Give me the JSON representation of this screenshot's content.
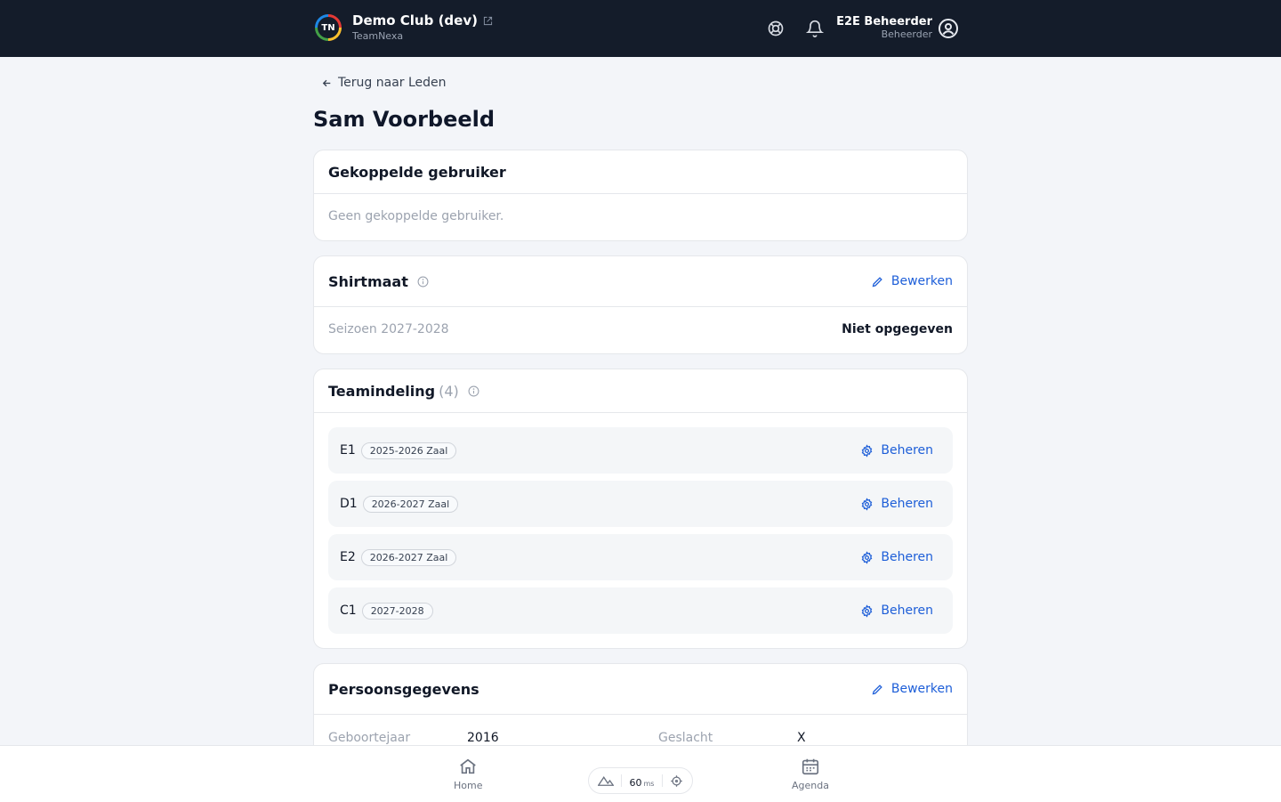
{
  "header": {
    "logo_text": "TN",
    "club_name": "Demo Club (dev)",
    "brand": "TeamNexa",
    "user_name": "E2E Beheerder",
    "user_role": "Beheerder"
  },
  "page": {
    "back_label": "Terug naar Leden",
    "title": "Sam Voorbeeld"
  },
  "linked_user": {
    "title": "Gekoppelde gebruiker",
    "empty": "Geen gekoppelde gebruiker."
  },
  "shirt": {
    "title": "Shirtmaat",
    "edit_label": "Bewerken",
    "season": "Seizoen 2027-2028",
    "value": "Niet opgegeven"
  },
  "teams": {
    "title": "Teamindeling",
    "count": "(4)",
    "manage_label": "Beheren",
    "rows": [
      {
        "code": "E1",
        "season": "2025-2026 Zaal"
      },
      {
        "code": "D1",
        "season": "2026-2027 Zaal"
      },
      {
        "code": "E2",
        "season": "2026-2027 Zaal"
      },
      {
        "code": "C1",
        "season": "2027-2028"
      }
    ]
  },
  "personal": {
    "title": "Persoonsgegevens",
    "edit_label": "Bewerken",
    "birth_year_label": "Geboortejaar",
    "birth_year": "2016",
    "gender_label": "Geslacht",
    "gender": "X"
  },
  "bottom_nav": {
    "home": "Home",
    "agenda": "Agenda",
    "perf_value": "60",
    "perf_unit": "ms"
  },
  "colors": {
    "header_bg": "#141c2a",
    "accent": "#1d5ed8",
    "page_bg": "#f3f5f9"
  }
}
